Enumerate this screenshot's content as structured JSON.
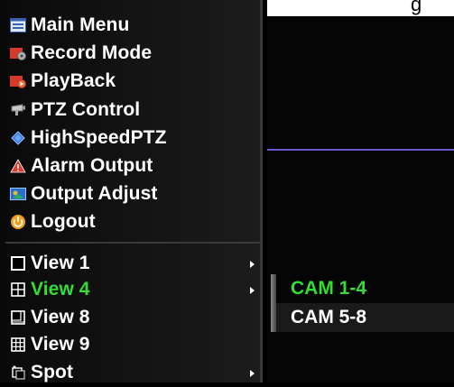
{
  "background": {
    "clipped_text": "g"
  },
  "menu": {
    "items": [
      {
        "label": "Main Menu",
        "icon": "main-menu-icon"
      },
      {
        "label": "Record Mode",
        "icon": "record-mode-icon"
      },
      {
        "label": "PlayBack",
        "icon": "playback-icon"
      },
      {
        "label": "PTZ Control",
        "icon": "ptz-control-icon"
      },
      {
        "label": "HighSpeedPTZ",
        "icon": "high-speed-ptz-icon"
      },
      {
        "label": "Alarm Output",
        "icon": "alarm-output-icon"
      },
      {
        "label": "Output Adjust",
        "icon": "output-adjust-icon"
      },
      {
        "label": "Logout",
        "icon": "logout-icon"
      }
    ],
    "view_items": [
      {
        "label": "View 1",
        "icon": "view-1-icon"
      },
      {
        "label": "View 4",
        "icon": "view-4-icon",
        "selected": true
      },
      {
        "label": "View 8",
        "icon": "view-8-icon"
      },
      {
        "label": "View 9",
        "icon": "view-9-icon"
      },
      {
        "label": "Spot",
        "icon": "spot-icon"
      }
    ]
  },
  "submenu": {
    "items": [
      {
        "label": "CAM 1-4",
        "selected": true
      },
      {
        "label": "CAM 5-8"
      }
    ]
  },
  "colors": {
    "selected_text": "#33dd33",
    "text": "#ffffff",
    "divider": "#3a3a3a",
    "background_line": "#6a58c8"
  }
}
